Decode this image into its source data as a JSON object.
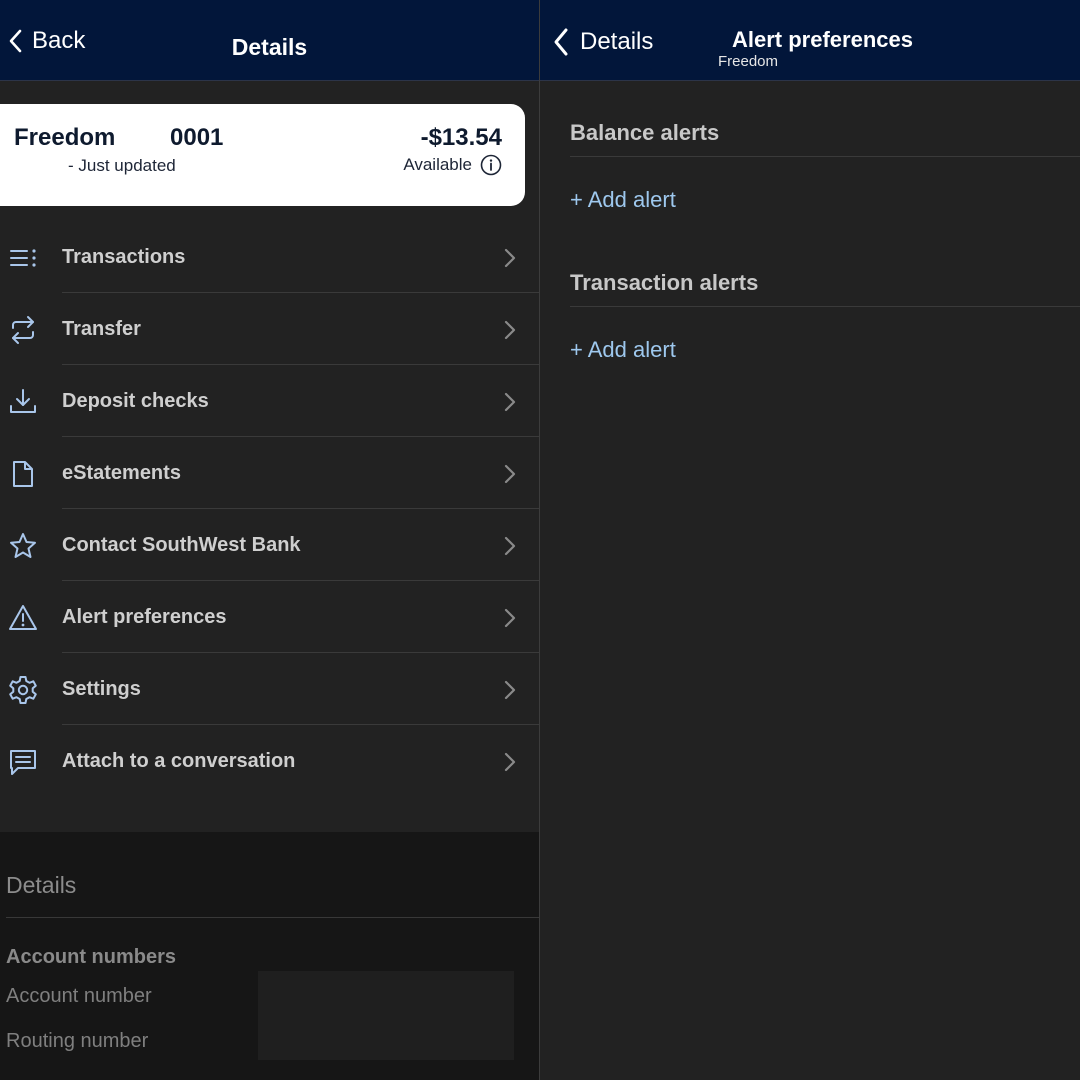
{
  "left": {
    "nav": {
      "back_label": "Back",
      "title": "Details"
    },
    "account": {
      "name": "Freedom",
      "number": "0001",
      "updated": "- Just updated",
      "balance": "-$13.54",
      "available_label": "Available"
    },
    "menu": [
      {
        "label": "Transactions",
        "icon": "list-icon"
      },
      {
        "label": "Transfer",
        "icon": "transfer-arrows-icon"
      },
      {
        "label": "Deposit checks",
        "icon": "download-tray-icon"
      },
      {
        "label": "eStatements",
        "icon": "document-icon"
      },
      {
        "label": "Contact SouthWest Bank",
        "icon": "star-icon"
      },
      {
        "label": "Alert preferences",
        "icon": "warning-triangle-icon"
      },
      {
        "label": "Settings",
        "icon": "gear-icon"
      },
      {
        "label": "Attach to a conversation",
        "icon": "chat-bubble-icon"
      }
    ],
    "details": {
      "title": "Details",
      "account_numbers_label": "Account numbers",
      "account_number_label": "Account number",
      "routing_number_label": "Routing number"
    }
  },
  "right": {
    "nav": {
      "back_label": "Details",
      "title": "Alert preferences",
      "subtitle": "Freedom"
    },
    "sections": [
      {
        "title": "Balance alerts",
        "add_label": "+ Add alert"
      },
      {
        "title": "Transaction alerts",
        "add_label": "+ Add alert"
      }
    ]
  },
  "colors": {
    "nav_bg": "#02163a",
    "pane_bg": "#222222",
    "link": "#9ec8ee",
    "icon": "#a9c6ea"
  }
}
